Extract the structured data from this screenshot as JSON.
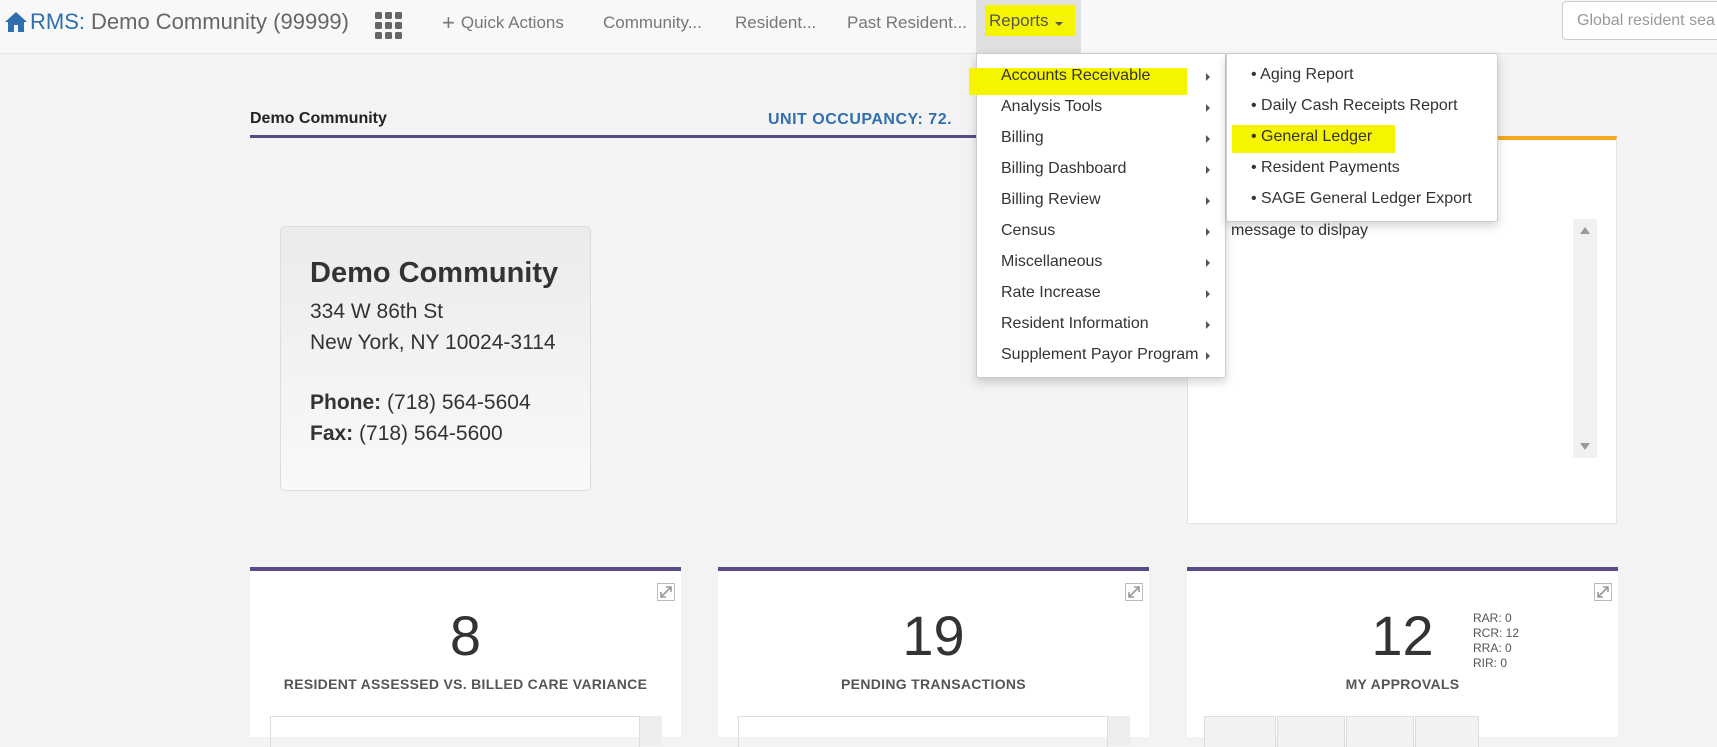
{
  "navbar": {
    "brand_rms": "RMS:",
    "brand_community": "Demo Community (99999)",
    "quick_actions": "Quick Actions",
    "community": "Community...",
    "resident": "Resident...",
    "past_resident": "Past Resident...",
    "reports": "Reports",
    "search_placeholder": "Global resident sea"
  },
  "page": {
    "community_heading": "Demo Community",
    "occupancy": "UNIT OCCUPANCY: 72."
  },
  "address_card": {
    "name": "Demo Community",
    "street": "334 W 86th St",
    "city_state_zip": "New York, NY 10024-3114",
    "phone_label": "Phone:",
    "phone": "(718) 564-5604",
    "fax_label": "Fax:",
    "fax": "(718) 564-5600"
  },
  "message_panel": {
    "text": "message to dislpay"
  },
  "stats": [
    {
      "number": "8",
      "label": "RESIDENT ASSESSED VS. BILLED CARE VARIANCE"
    },
    {
      "number": "19",
      "label": "PENDING TRANSACTIONS"
    },
    {
      "number": "12",
      "label": "MY APPROVALS"
    }
  ],
  "approvals": [
    "RAR: 0",
    "RCR: 12",
    "RRA: 0",
    "RIR: 0"
  ],
  "reports_menu": {
    "items": [
      "Accounts Receivable",
      "Analysis Tools",
      "Billing",
      "Billing Dashboard",
      "Billing Review",
      "Census",
      "Miscellaneous",
      "Rate Increase",
      "Resident Information",
      "Supplement Payor Program"
    ]
  },
  "accounts_receivable_submenu": {
    "items": [
      "Aging Report",
      "Daily Cash Receipts Report",
      "General Ledger",
      "Resident Payments",
      "SAGE General Ledger Export"
    ]
  },
  "colors": {
    "brand_blue": "#2f6fb0",
    "highlight_yellow": "#f5f500",
    "accent_purple": "#5b4a8a",
    "accent_orange": "#f5a623"
  }
}
